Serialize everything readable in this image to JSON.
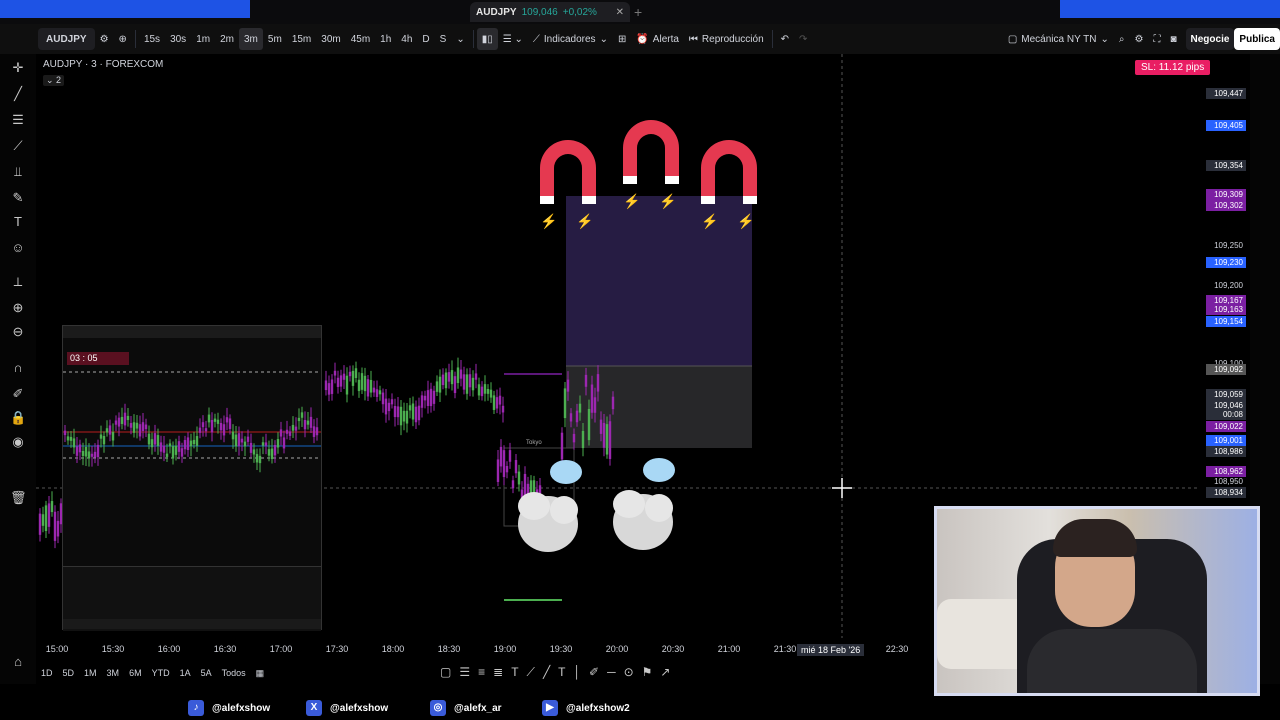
{
  "browser_tab": {
    "symbol": "AUDJPY",
    "price": "109,046",
    "change": "+0,02%",
    "close": "✕",
    "new_tab": "+"
  },
  "toolbar": {
    "symbol": "AUDJPY",
    "intervals": [
      "15s",
      "30s",
      "1m",
      "2m",
      "3m",
      "5m",
      "15m",
      "30m",
      "45m",
      "1h",
      "4h",
      "D",
      "S"
    ],
    "selected_interval": "3m",
    "indicators": "Indicadores",
    "alert": "Alerta",
    "replay": "Reproducción",
    "layout_name": "Mecánica NY TN",
    "trade": "Negocie",
    "publish": "Publica"
  },
  "chart": {
    "title": "AUDJPY · 3 · FOREXCOM",
    "sub": "⌄ 2",
    "sl_badge": "SL: 11.12 pips",
    "price_labels": [
      {
        "text": "109,447",
        "color": "#2a2e39"
      },
      {
        "text": "109,405",
        "color": "#2962ff"
      },
      {
        "text": "109,354",
        "color": "#2a2e39"
      },
      {
        "text": "109,309",
        "color": "#7b1fa2"
      },
      {
        "text": "109,302",
        "color": "#7b1fa2"
      },
      {
        "text": "109,250",
        "color": ""
      },
      {
        "text": "109,230",
        "color": "#2962ff"
      },
      {
        "text": "109,200",
        "color": ""
      },
      {
        "text": "109,167",
        "color": "#7b1fa2"
      },
      {
        "text": "109,163",
        "color": "#7b1fa2"
      },
      {
        "text": "109,154",
        "color": "#2962ff"
      },
      {
        "text": "109,100",
        "color": ""
      },
      {
        "text": "109,092",
        "color": "#555"
      },
      {
        "text": "109,059",
        "color": "#2a2e39"
      },
      {
        "text": "109,046",
        "color": "#2a2e39"
      },
      {
        "text": "00:08",
        "color": "#2a2e39"
      },
      {
        "text": "109,022",
        "color": "#7b1fa2"
      },
      {
        "text": "109,001",
        "color": "#2962ff"
      },
      {
        "text": "108,986",
        "color": "#2a2e39"
      },
      {
        "text": "108,962",
        "color": "#7b1fa2"
      },
      {
        "text": "108,950",
        "color": ""
      },
      {
        "text": "108,934",
        "color": "#2a2e39"
      }
    ],
    "time_labels": [
      "15:00",
      "15:30",
      "16:00",
      "16:30",
      "17:00",
      "17:30",
      "18:00",
      "18:30",
      "19:00",
      "19:30",
      "20:00",
      "20:30",
      "21:00",
      "21:30",
      "22:00",
      "22:30"
    ],
    "crosshair_date": "mié 18 Feb '26",
    "session_label": "Tokyo"
  },
  "bottom": {
    "ranges": [
      "1D",
      "5D",
      "1M",
      "3M",
      "6M",
      "YTD",
      "1A",
      "5A",
      "Todos"
    ]
  },
  "mt5": {
    "timer": "03 : 05"
  },
  "socials": [
    {
      "icon": "tiktok-icon",
      "glyph": "♪",
      "handle": "@alefxshow"
    },
    {
      "icon": "x-icon",
      "glyph": "X",
      "handle": "@alefxshow"
    },
    {
      "icon": "instagram-icon",
      "glyph": "◎",
      "handle": "@alefx_ar"
    },
    {
      "icon": "youtube-icon",
      "glyph": "▶",
      "handle": "@alefxshow2"
    }
  ],
  "colors": {
    "up": "#4caf50",
    "down": "#9c27b0",
    "zone": "#2a1f4a",
    "accent": "#1e53e5",
    "magnet": "#e53950"
  }
}
